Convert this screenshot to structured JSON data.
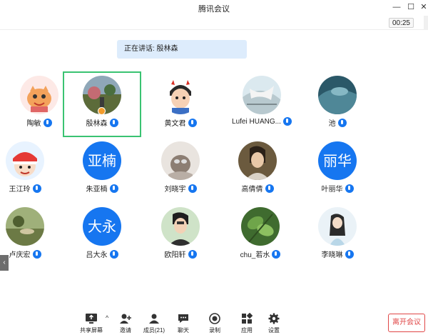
{
  "window": {
    "title": "腾讯会议",
    "minimize": "—",
    "maximize": "☐",
    "close": "✕"
  },
  "timer": "00:25",
  "speaking_banner": "正在讲话: 殷林森",
  "participants": [
    {
      "name": "陶敏"
    },
    {
      "name": "殷林森",
      "active": true,
      "host": true
    },
    {
      "name": "黄文君"
    },
    {
      "name": "Lufei HUANG..."
    },
    {
      "name": "池"
    },
    {
      "name": "王江玲"
    },
    {
      "name": "朱亚楠",
      "avatar_text": "亚楠"
    },
    {
      "name": "刘晓宇"
    },
    {
      "name": "高倩倩"
    },
    {
      "name": "叶丽华",
      "avatar_text": "丽华"
    },
    {
      "name": "卢庆宏"
    },
    {
      "name": "吕大永",
      "avatar_text": "大永"
    },
    {
      "name": "欧阳轩"
    },
    {
      "name": "chu_若水"
    },
    {
      "name": "李晓琳"
    }
  ],
  "toolbar": {
    "share": "共享屏幕",
    "invite": "邀请",
    "members": "成员(21)",
    "chat": "聊天",
    "record": "录制",
    "apps": "应用",
    "settings": "设置",
    "leave": "离开会议"
  },
  "colors": {
    "accent": "#1676f0",
    "active_border": "#3ac372",
    "leave": "#e04747",
    "banner": "#ddecfc"
  }
}
